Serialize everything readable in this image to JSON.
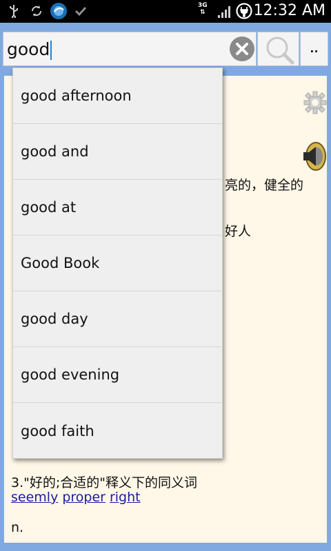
{
  "status_bar": {
    "network": "3G",
    "time": "12:32 AM"
  },
  "search": {
    "query": "good",
    "menu_label": ".."
  },
  "suggestions": [
    "good afternoon",
    "good and",
    "good at",
    "Good Book",
    "good day",
    "good evening",
    "good faith"
  ],
  "definition": {
    "line1_fragment": "亮的，健全的",
    "line2_fragment": "好人",
    "synonym_heading": "3.\"好的;合适的\"释义下的同义词",
    "synonyms": [
      "seemly",
      "proper",
      "right"
    ],
    "part_of_speech": "n."
  }
}
